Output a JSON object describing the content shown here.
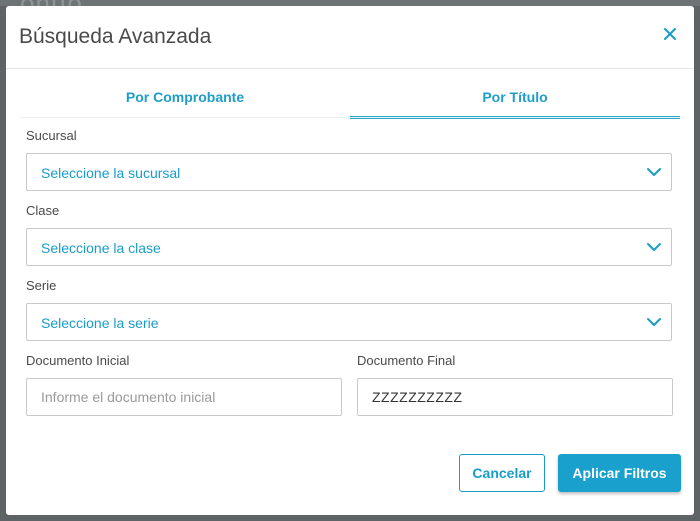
{
  "modal": {
    "title": "Búsqueda Avanzada",
    "close_icon": "close-icon"
  },
  "tabs": [
    {
      "label": "Por Comprobante",
      "active": false
    },
    {
      "label": "Por Título",
      "active": true
    }
  ],
  "form": {
    "sucursal": {
      "label": "Sucursal",
      "value": "Seleccione la sucursal"
    },
    "clase": {
      "label": "Clase",
      "value": "Seleccione la clase"
    },
    "serie": {
      "label": "Serie",
      "value": "Seleccione la serie"
    },
    "documento_inicial": {
      "label": "Documento Inicial",
      "placeholder": "Informe el documento inicial",
      "value": ""
    },
    "documento_final": {
      "label": "Documento Final",
      "value": "ZZZZZZZZZZ"
    }
  },
  "buttons": {
    "cancel": "Cancelar",
    "apply": "Aplicar Filtros"
  },
  "colors": {
    "accent": "#1aa0cc",
    "overlay": "#5e6466"
  }
}
